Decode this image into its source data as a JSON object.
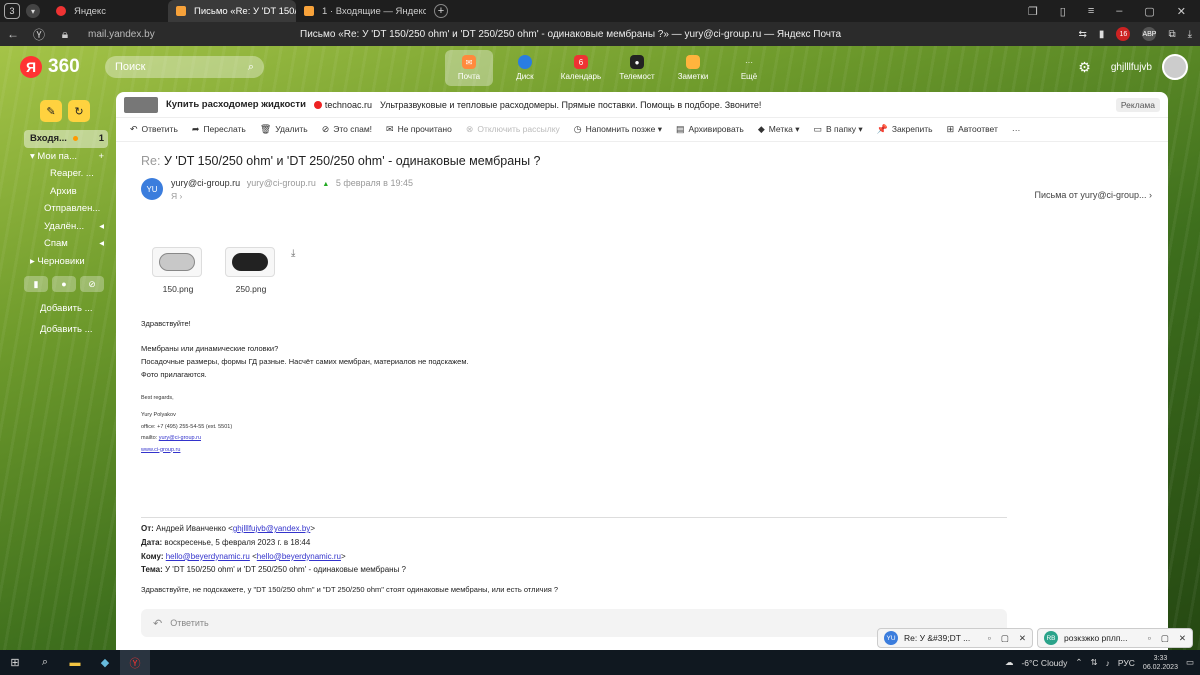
{
  "browser": {
    "tab_count": "3",
    "tabs": [
      {
        "title": "Яндекс",
        "active": false
      },
      {
        "title": "Письмо «Re: У 'DT 150/",
        "active": true
      },
      {
        "title": "1 · Входящие — Яндекс П",
        "active": false
      }
    ],
    "url": "mail.yandex.by",
    "page_title": "Письмо «Re: У 'DT 150/250 ohm' и 'DT 250/250 ohm' - одинаковые мембраны ?» — yury@ci-group.ru — Яндекс Почта",
    "ext_badge": "16",
    "abp": "ABP"
  },
  "header": {
    "logo_text": "360",
    "search_placeholder": "Поиск",
    "services": [
      {
        "label": "Почта",
        "icon": "mail-icon",
        "color": "#ff8a3d"
      },
      {
        "label": "Диск",
        "icon": "disk-icon",
        "color": "#2a7de1"
      },
      {
        "label": "Календарь",
        "icon": "calendar-icon",
        "color": "#e33",
        "badge": "6"
      },
      {
        "label": "Телемост",
        "icon": "telemost-icon",
        "color": "#222"
      },
      {
        "label": "Заметки",
        "icon": "notes-icon",
        "color": "#ffb43d"
      },
      {
        "label": "Ещё",
        "icon": "more-icon",
        "color": "transparent"
      }
    ],
    "username": "ghjlllfujvb"
  },
  "sidebar": {
    "folders": [
      {
        "label": "Входя...",
        "count": "1",
        "active": true
      },
      {
        "label": "▾ Мои па...",
        "plus": "+"
      },
      {
        "label": "Reaper. ..."
      },
      {
        "label": "Архив"
      },
      {
        "label": "Отправлен..."
      },
      {
        "label": "Удалён...",
        "icon": "◂"
      },
      {
        "label": "Спам",
        "icon": "◂"
      },
      {
        "label": "▸ Черновики"
      }
    ],
    "add_links": [
      "Добавить ...",
      "Добавить ..."
    ]
  },
  "ad": {
    "title": "Купить расходомер жидкости",
    "site": "technoac.ru",
    "text": "Ультразвуковые и тепловые расходомеры. Прямые поставки. Помощь в подборе. Звоните!",
    "label": "Реклама"
  },
  "toolbar": [
    {
      "icon": "↶",
      "label": "Ответить"
    },
    {
      "icon": "➦",
      "label": "Переслать"
    },
    {
      "icon": "🗑",
      "label": "Удалить"
    },
    {
      "icon": "⊘",
      "label": "Это спам!"
    },
    {
      "icon": "✉",
      "label": "Не прочитано"
    },
    {
      "icon": "⊗",
      "label": "Отключить рассылку",
      "disabled": true
    },
    {
      "icon": "◷",
      "label": "Напомнить позже ▾"
    },
    {
      "icon": "▤",
      "label": "Архивировать"
    },
    {
      "icon": "◆",
      "label": "Метка ▾"
    },
    {
      "icon": "▭",
      "label": "В папку ▾"
    },
    {
      "icon": "📌",
      "label": "Закрепить"
    },
    {
      "icon": "⊞",
      "label": "Автоответ"
    },
    {
      "icon": "",
      "label": "···"
    }
  ],
  "message": {
    "subject_prefix": "Re:",
    "subject": "У 'DT 150/250 ohm' и 'DT 250/250 ohm' - одинаковые мембраны ?",
    "avatar": "YU",
    "from_name": "yury@ci-group.ru",
    "from_email": "yury@ci-group.ru",
    "date": "5 февраля в 19:45",
    "to": "Я ›",
    "letters_from": "Письма от yury@ci-group...   ›",
    "attachments": [
      {
        "name": "150.png",
        "color": "#c8c8c8"
      },
      {
        "name": "250.png",
        "color": "#222222"
      }
    ],
    "body": [
      "Здравствуйте!",
      "",
      "Мембраны или динамические головки?",
      "Посадочные размеры, формы ГД разные. Насчёт самих мембран, материалов не подскажем.",
      "Фото прилагаются."
    ],
    "signature": {
      "regards": "Best regards,",
      "name": "Yury Polyakov",
      "office": "office: +7 (495) 255-54-55 (ext. 5501)",
      "mailto_label": "mailto: ",
      "mailto": "yury@ci-group.ru",
      "web": "www.ci-group.ru"
    },
    "quoted": {
      "from_label": "От:",
      "from": "Андрей Иванченко <",
      "from_email": "ghjlllfujvb@yandex.by",
      "from_end": ">",
      "date_label": "Дата:",
      "date": "воскресенье, 5 февраля 2023 г. в 18:44",
      "to_label": "Кому:",
      "to_email": "hello@beyerdynamic.ru",
      "to_mid": " <",
      "to_email2": "hello@beyerdynamic.ru",
      "to_end": ">",
      "subject_label": "Тема:",
      "subject": "У 'DT 150/250 ohm' и 'DT 250/250 ohm' - одинаковые мембраны ?",
      "text": "Здравствуйте, не подскажете, у \"DT 150/250 ohm\" и  \"DT 250/250 ohm\" стоят одинаковые мембраны, или есть отличия ?"
    },
    "reply_label": "Ответить"
  },
  "notifications": [
    {
      "avatar": "YU",
      "text": "Re: У &#39;DT ...",
      "color": "#3b7ddd"
    },
    {
      "avatar": "RB",
      "text": "розкзжко рплп...",
      "color": "#2aa38a"
    }
  ],
  "taskbar": {
    "weather": "-6°C  Cloudy",
    "lang": "РУС",
    "time": "3:33",
    "date": "06.02.2023"
  }
}
